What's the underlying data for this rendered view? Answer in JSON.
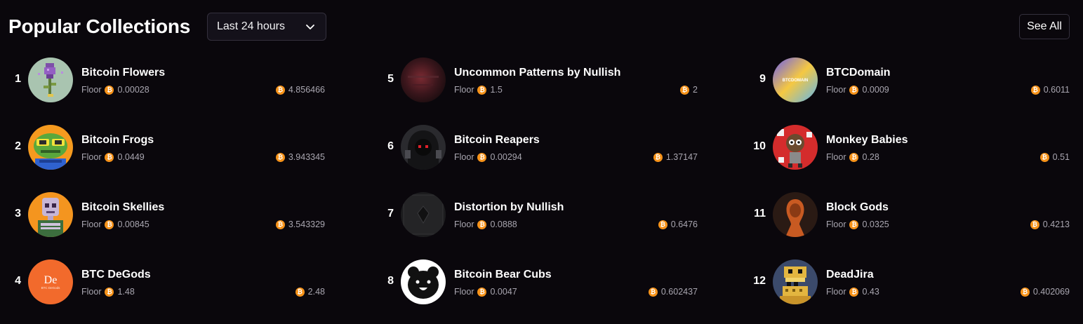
{
  "header": {
    "title": "Popular Collections",
    "timeframe": "Last 24 hours",
    "see_all": "See All"
  },
  "labels": {
    "floor": "Floor",
    "btc_symbol": "₿"
  },
  "colors": {
    "background": "#0a070c",
    "btc_orange": "#f7931a",
    "muted_text": "#a9a6b0"
  },
  "collections": [
    {
      "rank": "1",
      "name": "Bitcoin Flowers",
      "floor": "0.00028",
      "volume": "4.856466"
    },
    {
      "rank": "2",
      "name": "Bitcoin Frogs",
      "floor": "0.0449",
      "volume": "3.943345"
    },
    {
      "rank": "3",
      "name": "Bitcoin Skellies",
      "floor": "0.00845",
      "volume": "3.543329"
    },
    {
      "rank": "4",
      "name": "BTC DeGods",
      "floor": "1.48",
      "volume": "2.48",
      "avatar_text": "De",
      "avatar_subtext": "BTC DeGods"
    },
    {
      "rank": "5",
      "name": "Uncommon Patterns by Nullish",
      "floor": "1.5",
      "volume": "2"
    },
    {
      "rank": "6",
      "name": "Bitcoin Reapers",
      "floor": "0.00294",
      "volume": "1.37147"
    },
    {
      "rank": "7",
      "name": "Distortion by Nullish",
      "floor": "0.0888",
      "volume": "0.6476"
    },
    {
      "rank": "8",
      "name": "Bitcoin Bear Cubs",
      "floor": "0.0047",
      "volume": "0.602437"
    },
    {
      "rank": "9",
      "name": "BTCDomain",
      "floor": "0.0009",
      "volume": "0.6011",
      "avatar_text": "BTCDOMAIN"
    },
    {
      "rank": "10",
      "name": "Monkey Babies",
      "floor": "0.28",
      "volume": "0.51"
    },
    {
      "rank": "11",
      "name": "Block Gods",
      "floor": "0.0325",
      "volume": "0.4213"
    },
    {
      "rank": "12",
      "name": "DeadJira",
      "floor": "0.43",
      "volume": "0.402069"
    }
  ]
}
